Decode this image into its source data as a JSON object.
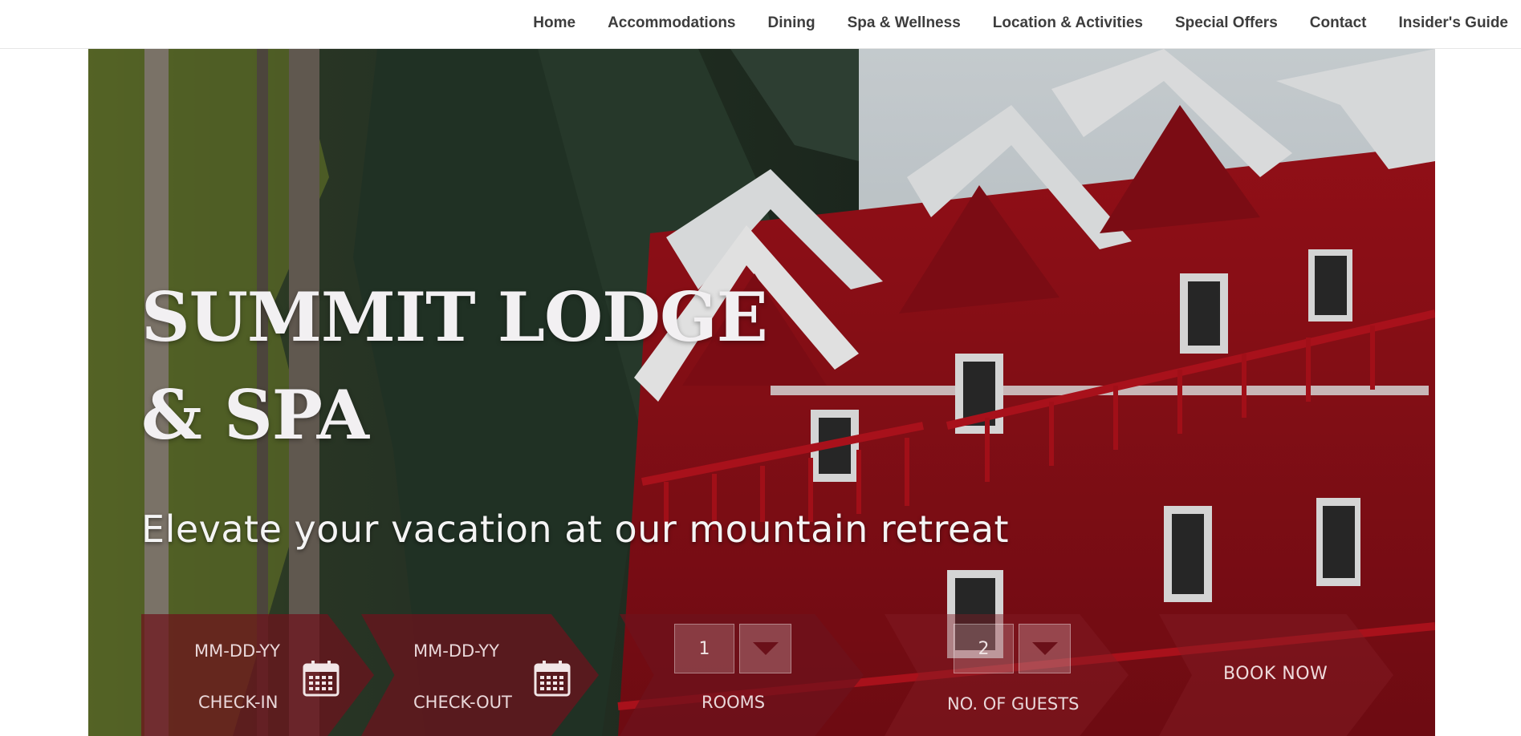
{
  "nav": {
    "items": [
      {
        "label": "Home"
      },
      {
        "label": "Accommodations"
      },
      {
        "label": "Dining"
      },
      {
        "label": "Spa & Wellness"
      },
      {
        "label": "Location & Activities"
      },
      {
        "label": "Special Offers"
      },
      {
        "label": "Contact"
      },
      {
        "label": "Insider's Guide"
      }
    ]
  },
  "hero": {
    "title_line1": "SUMMIT LODGE",
    "title_line2": "& SPA",
    "subtitle": "Elevate your vacation at our mountain retreat"
  },
  "booking": {
    "checkin": {
      "placeholder": "MM-DD-YY",
      "label": "CHECK-IN",
      "icon": "calendar-icon"
    },
    "checkout": {
      "placeholder": "MM-DD-YY",
      "label": "CHECK-OUT",
      "icon": "calendar-icon"
    },
    "rooms": {
      "value": "1",
      "label": "ROOMS",
      "icon": "chevron-down-icon"
    },
    "guests": {
      "value": "2",
      "label": "NO. OF GUESTS",
      "icon": "chevron-down-icon"
    },
    "book_now": "BOOK NOW"
  },
  "colors": {
    "nav_text": "#3d3d3d",
    "booking_bg": "#6e121c",
    "lodge_red": "#b3121d"
  }
}
